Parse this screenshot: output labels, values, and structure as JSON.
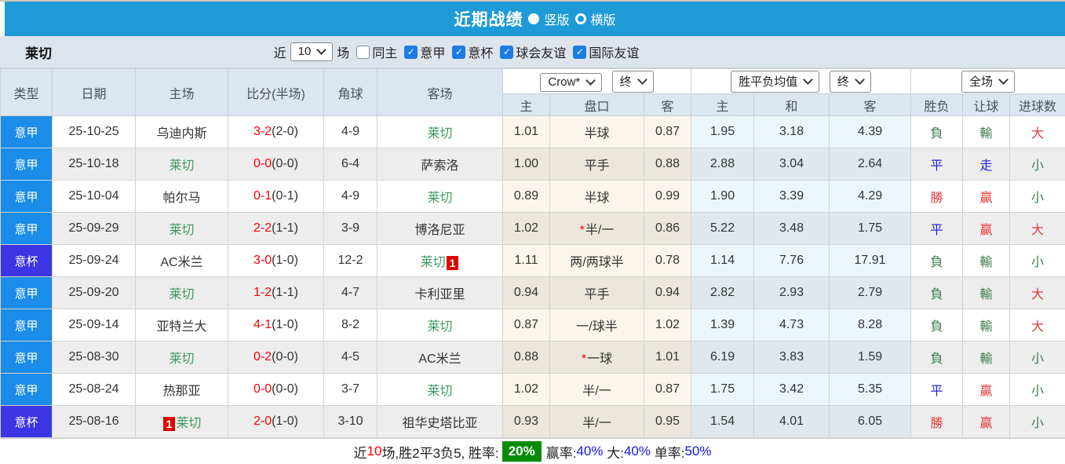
{
  "title_bar": {
    "title": "近期战绩",
    "radio_vertical": "竖版",
    "radio_horizontal": "横版"
  },
  "filter": {
    "team": "莱切",
    "near_label": "近",
    "rounds_value": "10",
    "rounds_label": "场",
    "same_home": {
      "label": "同主",
      "checked": false
    },
    "checkboxes": [
      {
        "label": "意甲",
        "checked": true
      },
      {
        "label": "意杯",
        "checked": true
      },
      {
        "label": "球会友谊",
        "checked": true
      },
      {
        "label": "国际友谊",
        "checked": true
      }
    ]
  },
  "selects": {
    "bookmaker": "Crow*",
    "bookmaker_period": "终",
    "odds_view": "胜平负均值",
    "odds_period": "终",
    "scope": "全场"
  },
  "table": {
    "headers": {
      "type": "类型",
      "date": "日期",
      "home": "主场",
      "score": "比分(半场)",
      "corner": "角球",
      "away": "客场",
      "ah_home": "主",
      "ah_line": "盘口",
      "ah_away": "客",
      "eu_home": "主",
      "eu_draw": "和",
      "eu_away": "客",
      "result": "胜负",
      "handicap": "让球",
      "goals": "进球数"
    },
    "rows": [
      {
        "type": "意甲",
        "cup": false,
        "date": "25-10-25",
        "home": "乌迪内斯",
        "home_team": false,
        "home_badge": "",
        "score": "3-2",
        "half": "(2-0)",
        "corner": "4-9",
        "away": "莱切",
        "away_team": true,
        "away_badge": "",
        "ah_home": "1.01",
        "line_star": "",
        "line": "半球",
        "ah_away": "0.87",
        "eu_home": "1.95",
        "eu_draw": "3.18",
        "eu_away": "4.39",
        "result": "負",
        "result_c": "green",
        "hcp": "輸",
        "hcp_c": "green",
        "goals": "大",
        "goals_c": "red"
      },
      {
        "type": "意甲",
        "cup": false,
        "date": "25-10-18",
        "home": "莱切",
        "home_team": true,
        "home_badge": "",
        "score": "0-0",
        "half": "(0-0)",
        "corner": "6-4",
        "away": "萨索洛",
        "away_team": false,
        "away_badge": "",
        "ah_home": "1.00",
        "line_star": "",
        "line": "平手",
        "ah_away": "0.88",
        "eu_home": "2.88",
        "eu_draw": "3.04",
        "eu_away": "2.64",
        "result": "平",
        "result_c": "blue",
        "hcp": "走",
        "hcp_c": "blue",
        "goals": "小",
        "goals_c": "green"
      },
      {
        "type": "意甲",
        "cup": false,
        "date": "25-10-04",
        "home": "帕尔马",
        "home_team": false,
        "home_badge": "",
        "score": "0-1",
        "half": "(0-1)",
        "corner": "4-9",
        "away": "莱切",
        "away_team": true,
        "away_badge": "",
        "ah_home": "0.89",
        "line_star": "",
        "line": "半球",
        "ah_away": "0.99",
        "eu_home": "1.90",
        "eu_draw": "3.39",
        "eu_away": "4.29",
        "result": "勝",
        "result_c": "red",
        "hcp": "贏",
        "hcp_c": "red",
        "goals": "小",
        "goals_c": "green"
      },
      {
        "type": "意甲",
        "cup": false,
        "date": "25-09-29",
        "home": "莱切",
        "home_team": true,
        "home_badge": "",
        "score": "2-2",
        "half": "(1-1)",
        "corner": "3-9",
        "away": "博洛尼亚",
        "away_team": false,
        "away_badge": "",
        "ah_home": "1.02",
        "line_star": "*",
        "line": "半/一",
        "ah_away": "0.86",
        "eu_home": "5.22",
        "eu_draw": "3.48",
        "eu_away": "1.75",
        "result": "平",
        "result_c": "blue",
        "hcp": "贏",
        "hcp_c": "red",
        "goals": "大",
        "goals_c": "red"
      },
      {
        "type": "意杯",
        "cup": true,
        "date": "25-09-24",
        "home": "AC米兰",
        "home_team": false,
        "home_badge": "",
        "score": "3-0",
        "half": "(1-0)",
        "corner": "12-2",
        "away": "莱切",
        "away_team": true,
        "away_badge": "1",
        "ah_home": "1.11",
        "line_star": "",
        "line": "两/两球半",
        "ah_away": "0.78",
        "eu_home": "1.14",
        "eu_draw": "7.76",
        "eu_away": "17.91",
        "result": "負",
        "result_c": "green",
        "hcp": "輸",
        "hcp_c": "green",
        "goals": "小",
        "goals_c": "green"
      },
      {
        "type": "意甲",
        "cup": false,
        "date": "25-09-20",
        "home": "莱切",
        "home_team": true,
        "home_badge": "",
        "score": "1-2",
        "half": "(1-1)",
        "corner": "4-7",
        "away": "卡利亚里",
        "away_team": false,
        "away_badge": "",
        "ah_home": "0.94",
        "line_star": "",
        "line": "平手",
        "ah_away": "0.94",
        "eu_home": "2.82",
        "eu_draw": "2.93",
        "eu_away": "2.79",
        "result": "負",
        "result_c": "green",
        "hcp": "輸",
        "hcp_c": "green",
        "goals": "大",
        "goals_c": "red"
      },
      {
        "type": "意甲",
        "cup": false,
        "date": "25-09-14",
        "home": "亚特兰大",
        "home_team": false,
        "home_badge": "",
        "score": "4-1",
        "half": "(1-0)",
        "corner": "8-2",
        "away": "莱切",
        "away_team": true,
        "away_badge": "",
        "ah_home": "0.87",
        "line_star": "",
        "line": "一/球半",
        "ah_away": "1.02",
        "eu_home": "1.39",
        "eu_draw": "4.73",
        "eu_away": "8.28",
        "result": "負",
        "result_c": "green",
        "hcp": "輸",
        "hcp_c": "green",
        "goals": "大",
        "goals_c": "red"
      },
      {
        "type": "意甲",
        "cup": false,
        "date": "25-08-30",
        "home": "莱切",
        "home_team": true,
        "home_badge": "",
        "score": "0-2",
        "half": "(0-0)",
        "corner": "4-5",
        "away": "AC米兰",
        "away_team": false,
        "away_badge": "",
        "ah_home": "0.88",
        "line_star": "*",
        "line": "一球",
        "ah_away": "1.01",
        "eu_home": "6.19",
        "eu_draw": "3.83",
        "eu_away": "1.59",
        "result": "負",
        "result_c": "green",
        "hcp": "輸",
        "hcp_c": "green",
        "goals": "小",
        "goals_c": "green"
      },
      {
        "type": "意甲",
        "cup": false,
        "date": "25-08-24",
        "home": "热那亚",
        "home_team": false,
        "home_badge": "",
        "score": "0-0",
        "half": "(0-0)",
        "corner": "3-7",
        "away": "莱切",
        "away_team": true,
        "away_badge": "",
        "ah_home": "1.02",
        "line_star": "",
        "line": "半/一",
        "ah_away": "0.87",
        "eu_home": "1.75",
        "eu_draw": "3.42",
        "eu_away": "5.35",
        "result": "平",
        "result_c": "blue",
        "hcp": "贏",
        "hcp_c": "red",
        "goals": "小",
        "goals_c": "green"
      },
      {
        "type": "意杯",
        "cup": true,
        "date": "25-08-16",
        "home": "莱切",
        "home_team": true,
        "home_badge": "1",
        "score": "2-0",
        "half": "(1-0)",
        "corner": "3-10",
        "away": "祖华史塔比亚",
        "away_team": false,
        "away_badge": "",
        "ah_home": "0.93",
        "line_star": "",
        "line": "半/一",
        "ah_away": "0.95",
        "eu_home": "1.54",
        "eu_draw": "4.01",
        "eu_away": "6.05",
        "result": "勝",
        "result_c": "red",
        "hcp": "贏",
        "hcp_c": "red",
        "goals": "小",
        "goals_c": "green"
      }
    ]
  },
  "footer": {
    "near": "近",
    "games": "10",
    "summary": "场,胜2平3负5, 胜率:",
    "rate_badge": "20%",
    "win_label": "赢率:",
    "win_value": "40%",
    "big_label": " 大:",
    "big_value": "40%",
    "single_label": " 单率:",
    "single_value": "50%"
  },
  "colors": {
    "title_bar": "#1e9ad6",
    "filter_bg": "#dee4ec",
    "header_bg": "#dce6f0",
    "league_badge": "#1b8ce8",
    "cup_badge": "#3d35e4",
    "team_green": "#3f9a62",
    "score_red": "#ff0000",
    "result_red": "#e23b3b",
    "result_green": "#3d7a50",
    "result_blue": "#2323dd",
    "rate_badge_green": "#068c06",
    "footer_blue": "#1414e6",
    "handicap_col_bg": "#fbf6ec",
    "euro_col_bg": "#ecf5fa"
  }
}
